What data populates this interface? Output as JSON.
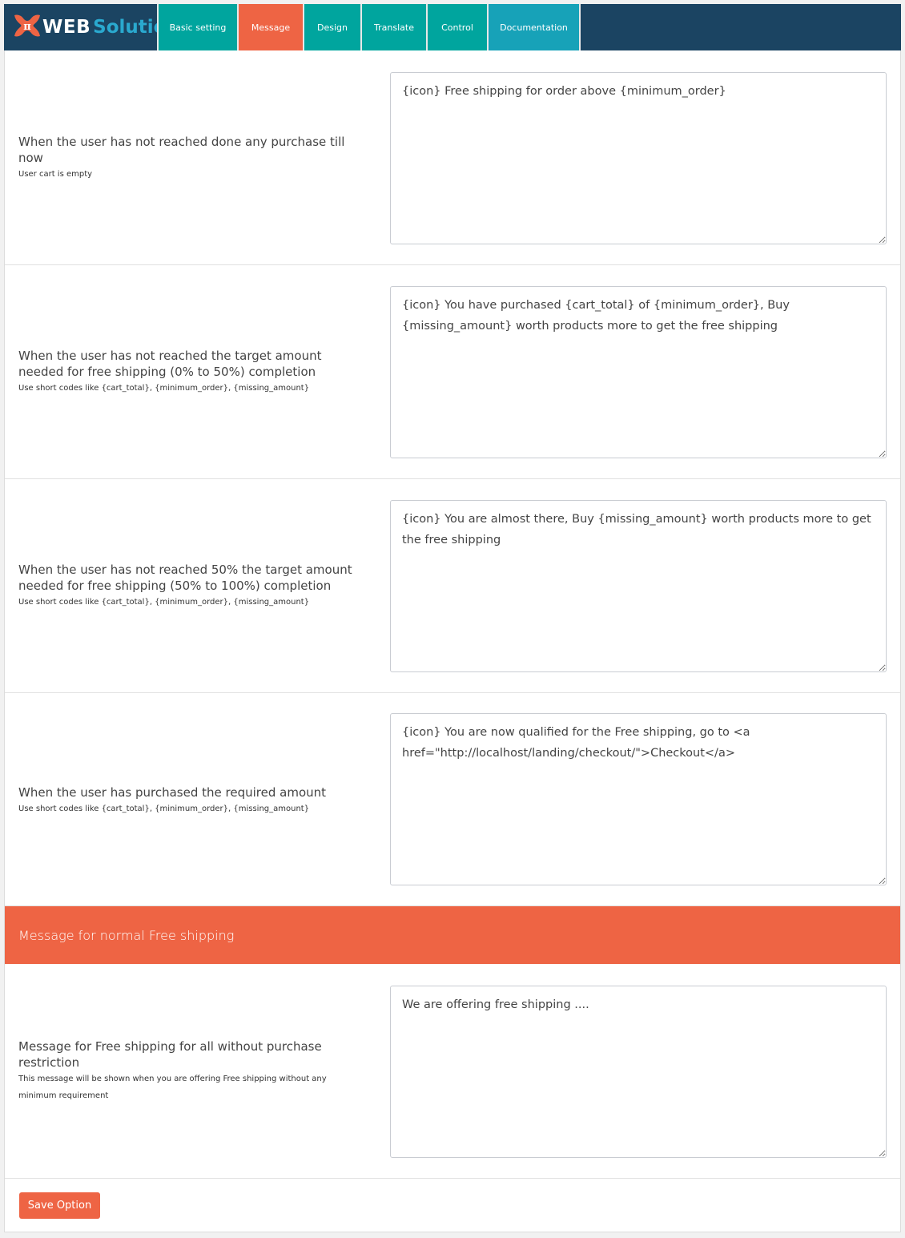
{
  "brand": {
    "logo_icon": "pi-x-logo-icon",
    "name_part1": "WEB",
    "name_part2": "Solution"
  },
  "tabs": [
    {
      "label": "Basic setting",
      "active": false
    },
    {
      "label": "Message",
      "active": true
    },
    {
      "label": "Design",
      "active": false
    },
    {
      "label": "Translate",
      "active": false
    },
    {
      "label": "Control",
      "active": false
    },
    {
      "label": "Documentation",
      "active": false
    }
  ],
  "rows": [
    {
      "label": "When the user has not reached done any purchase till now",
      "sublabel": "User cart is empty",
      "value": "{icon} Free shipping for order above {minimum_order}"
    },
    {
      "label": "When the user has not reached the target amount needed for free shipping (0% to 50%) completion",
      "sublabel": "Use short codes like {cart_total}, {minimum_order}, {missing_amount}",
      "value": "{icon} You have purchased {cart_total} of {minimum_order}, Buy {missing_amount} worth products more to get the free shipping"
    },
    {
      "label": "When the user has not reached 50% the target amount needed for free shipping (50% to 100%) completion",
      "sublabel": "Use short codes like {cart_total}, {minimum_order}, {missing_amount}",
      "value": "{icon} You are almost there, Buy {missing_amount} worth products more to get the free shipping"
    },
    {
      "label": "When the user has purchased the required amount",
      "sublabel": "Use short codes like {cart_total}, {minimum_order}, {missing_amount}",
      "value": "{icon} You are now qualified for the Free shipping, go to <a href=\"http://localhost/landing/checkout/\">Checkout</a>"
    }
  ],
  "section": {
    "title": "Message for normal Free shipping"
  },
  "normal_row": {
    "label": "Message for Free shipping for all without purchase restriction",
    "sublabel": "This message will be shown when you are offering Free shipping without any minimum requirement",
    "value": "We are offering free shipping ...."
  },
  "actions": {
    "save_label": "Save Option"
  },
  "colors": {
    "header_bg": "#1b4462",
    "tab_bg": "#00a59e",
    "tab_active_bg": "#ee6444",
    "tab_doc_bg": "#17a2b8",
    "accent": "#ee6444",
    "brand_secondary": "#2aa9cf"
  }
}
